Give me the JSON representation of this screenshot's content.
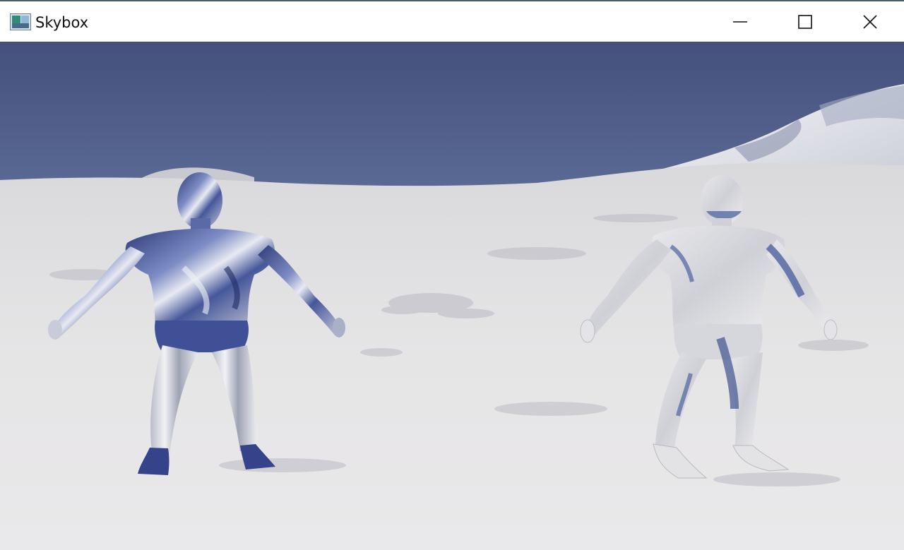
{
  "window": {
    "title": "Skybox",
    "controls": {
      "minimize_icon": "minimize-icon",
      "maximize_icon": "maximize-icon",
      "close_icon": "close-icon"
    }
  },
  "scene": {
    "sky_top": "#45507c",
    "sky_bottom": "#5f6f9c",
    "snow": "#e4e3e4",
    "mountain": "#c8cbd4",
    "chrome_blue": "#3a4b8c",
    "glass_grey": "#d8d8d8",
    "objects": [
      "reflective-figure",
      "refractive-figure"
    ]
  }
}
